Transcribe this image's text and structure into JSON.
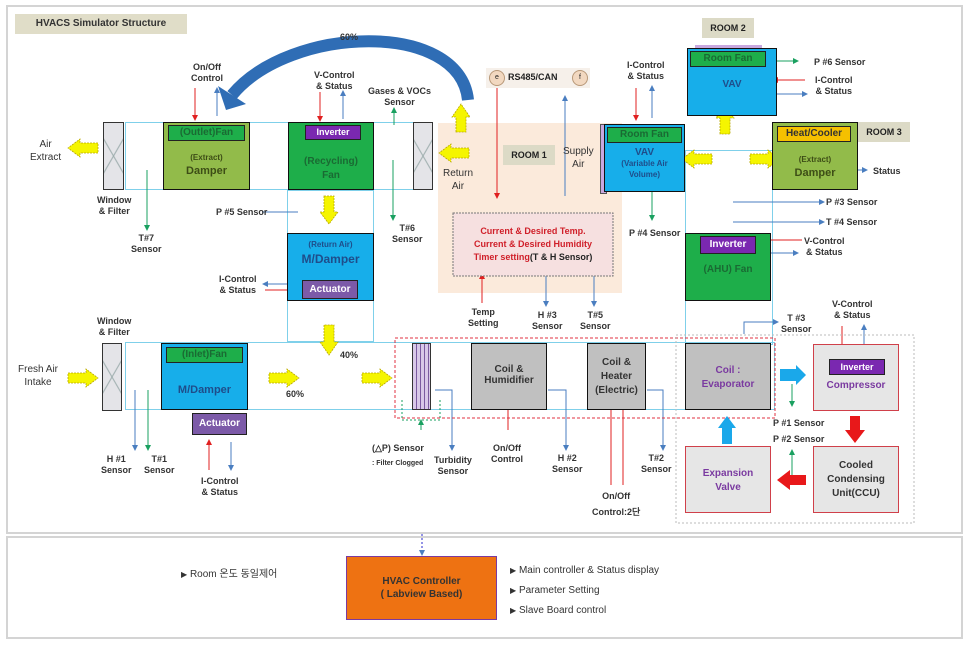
{
  "title": "HVACS Simulator Structure",
  "top_labels": {
    "recycle_pct": "60%",
    "air_extract": [
      "Air",
      "Extract"
    ],
    "fresh_air_intake": [
      "Fresh Air",
      "Intake"
    ],
    "return_air": [
      "Return",
      "Air"
    ],
    "supply_air": [
      "Supply",
      "Air"
    ],
    "rs485": "RS485/CAN",
    "rs485_left_circle": "e",
    "rs485_right_circle": "f",
    "inlet_pct": "60%",
    "mix_pct": "40%"
  },
  "rooms": {
    "room1": "ROOM 1",
    "room2": "ROOM 2",
    "room3": "ROOM 3"
  },
  "components": {
    "outlet_fan": {
      "tag": "(Outlet)Fan",
      "line1": "(Extract)",
      "line2": "Damper"
    },
    "recycling_fan": {
      "tag": "Inverter",
      "line1": "(Recycling)",
      "line2": "Fan"
    },
    "return_damper": {
      "line1": "(Return Air)",
      "line2": "M/Damper",
      "tag": "Actuator"
    },
    "inlet_fan": {
      "tag": "(Inlet)Fan",
      "line1": "M/Damper",
      "actuator": "Actuator"
    },
    "room1_controller": {
      "line1": "Current & Desired Temp.",
      "line2": "Current & Desired Humidity",
      "line3a": "Timer setting",
      "line3b": "(T & H Sensor)"
    },
    "vav_room1": {
      "tag": "Room Fan",
      "line1": "VAV",
      "line2": "(Variable Air",
      "line3": "Volume)"
    },
    "vav_room2": {
      "tag": "Room Fan",
      "line1": "VAV"
    },
    "room3_damper": {
      "tag": "Heat/Cooler",
      "line1": "(Extract)",
      "line2": "Damper"
    },
    "ahu_fan": {
      "tag": "Inverter",
      "line1": "(AHU) Fan"
    },
    "coil_humidifier": {
      "line1": "Coil &",
      "line2": "Humidifier"
    },
    "coil_heater": {
      "line1": "Coil &",
      "line2": "Heater",
      "line3": "(Electric)"
    },
    "evaporator": {
      "line1": "Coil  :",
      "line2": "Evaporator"
    },
    "compressor": {
      "tag": "Inverter",
      "line1": "Compressor"
    },
    "expansion_valve": {
      "line1": "Expansion",
      "line2": "Valve"
    },
    "ccu": {
      "line1": "Cooled",
      "line2": "Condensing",
      "line3": "Unit(CCU)"
    }
  },
  "signals": {
    "on_off_control_top": [
      "On/Off",
      "Control"
    ],
    "v_control_recycling": [
      "V-Control",
      "& Status"
    ],
    "gases_vocs": [
      "Gases & VOCs",
      "Sensor"
    ],
    "i_control_vav1": [
      "I-Control",
      "& Status"
    ],
    "p6": "P #6 Sensor",
    "i_control_room2": [
      "I-Control",
      "& Status"
    ],
    "status_room3": "Status",
    "window_filter_top": [
      "Window",
      "& Filter"
    ],
    "t7": [
      "T#7",
      "Sensor"
    ],
    "p5": "P #5 Sensor",
    "t6": [
      "T#6",
      "Sensor"
    ],
    "p4": "P #4 Sensor",
    "p3": "P #3 Sensor",
    "t4": "T #4 Sensor",
    "v_control_ahu": [
      "V-Control",
      "& Status"
    ],
    "i_control_return": [
      "I-Control",
      "& Status"
    ],
    "temp_setting": [
      "Temp",
      "Setting"
    ],
    "h3": [
      "H #3",
      "Sensor"
    ],
    "t5": [
      "T#5",
      "Sensor"
    ],
    "t3": [
      "T #3",
      "Sensor"
    ],
    "v_control_comp": [
      "V-Control",
      "& Status"
    ],
    "window_filter_bottom": [
      "Window",
      "& Filter"
    ],
    "h1": [
      "H #1",
      "Sensor"
    ],
    "t1": [
      "T#1",
      "Sensor"
    ],
    "i_control_inlet": [
      "I-Control",
      "& Status"
    ],
    "dp_sensor": "(△P) Sensor",
    "filter_clogged": ": Filter Clogged",
    "turbidity": [
      "Turbidity",
      "Sensor"
    ],
    "on_off_humid": [
      "On/Off",
      "Control"
    ],
    "h2": [
      "H #2",
      "Sensor"
    ],
    "on_off_heater": [
      "On/Off",
      "Control:2단"
    ],
    "t2": [
      "T#2",
      "Sensor"
    ],
    "p1": "P #1 Sensor",
    "p2": "P #2 Sensor"
  },
  "bottom": {
    "left_bullet": "Room 온도 동일제어",
    "controller_line1": "HVAC Controller",
    "controller_line2": "( Labview Based)",
    "bullets": [
      "Main controller & Status display",
      "Parameter Setting",
      "Slave Board control"
    ],
    "bullet_glyph": "▶"
  },
  "colors": {
    "fan_green": "#1eae4a",
    "damper_blue": "#17aeea",
    "extract_olive": "#92bb4a",
    "inverter_purple": "#7a28b0",
    "controller_orange": "#ee7212",
    "control_red": "#e02020",
    "status_blue": "#4a7ec0",
    "sensor_green": "#1aa060"
  }
}
